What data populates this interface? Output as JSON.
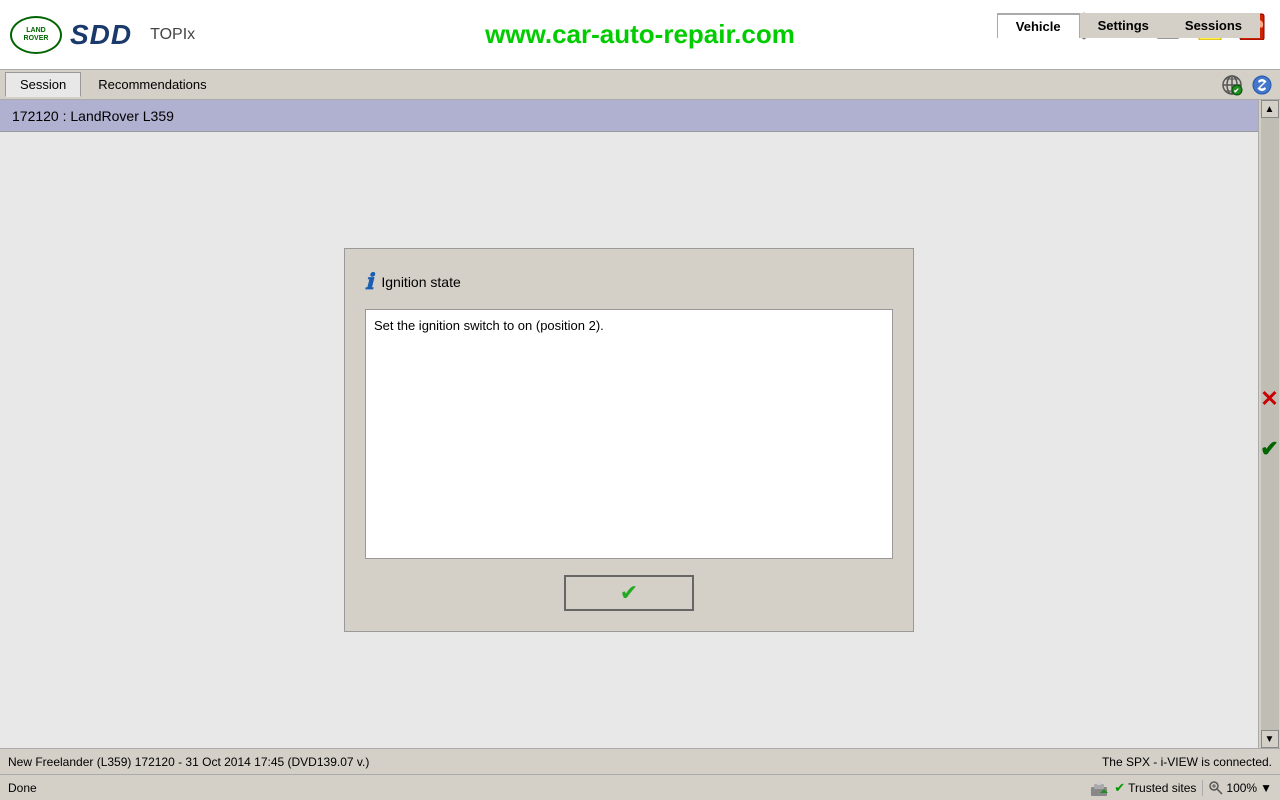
{
  "header": {
    "logo_text": "LAND\nROVER",
    "sdd_label": "SDD",
    "topix_label": "TOPIx",
    "website": "www.car-auto-repair.com",
    "nav_buttons": [
      "Vehicle",
      "Settings",
      "Sessions"
    ],
    "active_nav": "Vehicle",
    "icons": [
      "gear",
      "tag",
      "calendar",
      "note",
      "cup"
    ]
  },
  "tabs": {
    "items": [
      "Session",
      "Recommendations"
    ],
    "active": "Session"
  },
  "vehicle_header": {
    "text": "172120 : LandRover L359"
  },
  "dialog": {
    "title": "Ignition state",
    "content": "Set the ignition switch to on (position 2).",
    "confirm_icon": "✔"
  },
  "statusbar": {
    "text": "New Freelander (L359) 172120 - 31 Oct 2014 17:45 (DVD139.07 v.)",
    "right_text": "The SPX - i-VIEW is connected."
  },
  "ie_bar": {
    "done_label": "Done",
    "trusted_check": "✔",
    "trusted_label": "Trusted sites",
    "zoom_label": "100%",
    "zoom_arrow": "▼"
  }
}
